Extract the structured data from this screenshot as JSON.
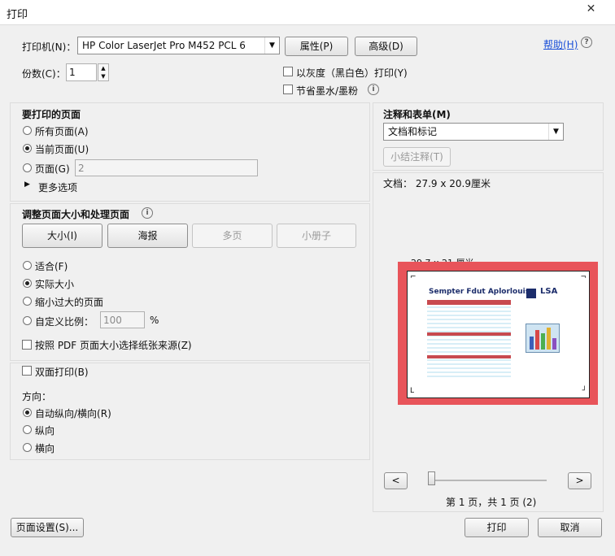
{
  "window": {
    "title": "打印",
    "close": "✕"
  },
  "top": {
    "printer_label": "打印机(N)：",
    "printer_value": "HP Color LaserJet Pro M452 PCL 6",
    "properties": "属性(P)",
    "advanced": "高级(D)",
    "help": "帮助(H)",
    "copies_label": "份数(C)：",
    "copies_value": "1",
    "grayscale": "以灰度（黑白色）打印(Y)",
    "save_ink": "节省墨水/墨粉"
  },
  "pages": {
    "heading": "要打印的页面",
    "all": "所有页面(A)",
    "current": "当前页面(U)",
    "pages": "页面(G)",
    "pages_value": "2",
    "more": "更多选项"
  },
  "sizing": {
    "heading": "调整页面大小和处理页面",
    "tabs": [
      "大小(I)",
      "海报",
      "多页",
      "小册子"
    ],
    "fit": "适合(F)",
    "actual": "实际大小",
    "shrink": "缩小过大的页面",
    "custom": "自定义比例：",
    "custom_value": "100",
    "percent": "%",
    "pdf_source": "按照 PDF 页面大小选择纸张来源(Z)"
  },
  "duplex": {
    "label": "双面打印(B)",
    "orientation": "方向：",
    "auto": "自动纵向/横向(R)",
    "portrait": "纵向",
    "landscape": "横向"
  },
  "comments": {
    "heading": "注释和表单(M)",
    "value": "文档和标记",
    "summarize": "小结注释(T)"
  },
  "preview": {
    "doc_size": "文档： 27.9 x 20.9厘米",
    "paper_size": "29.7 x 21 厘米",
    "doc_title": "Sempter Fdut Aplorlouis",
    "doc_logo": "LSA",
    "prev": "<",
    "next": ">",
    "page_status": "第 1 页，共 1 页 (2)",
    "slider_position": 0
  },
  "bottom": {
    "page_setup": "页面设置(S)...",
    "print": "打印",
    "cancel": "取消"
  },
  "colors": {
    "highlight": "#e8545a",
    "link": "#1a4fd8"
  }
}
